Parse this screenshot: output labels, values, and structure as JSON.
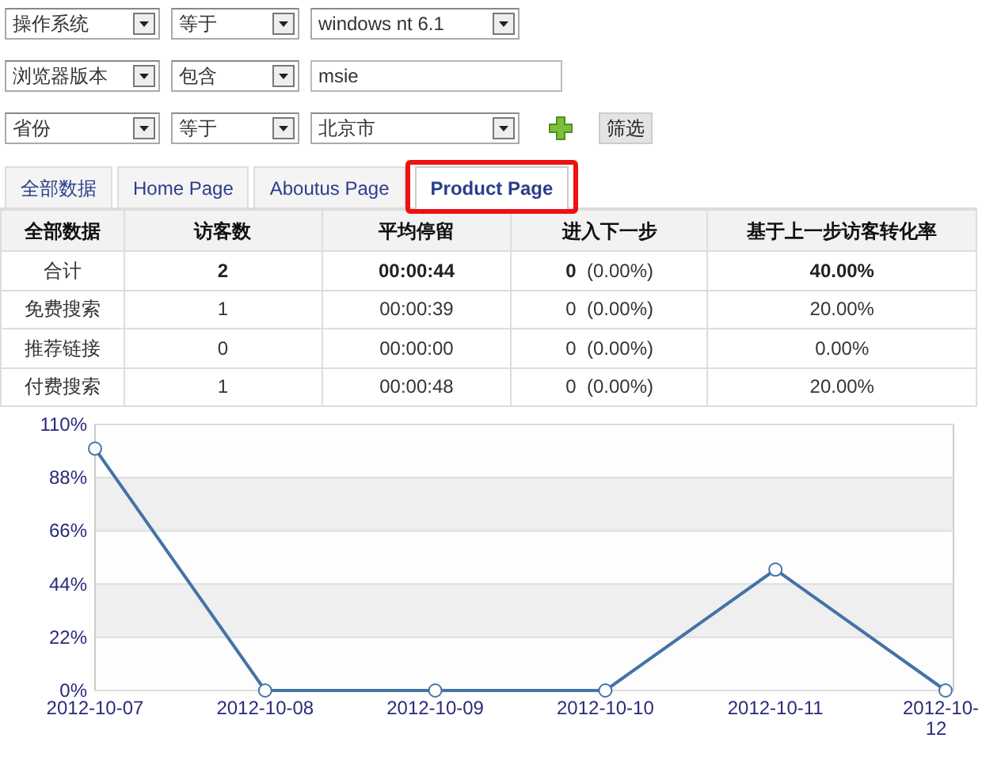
{
  "filters": [
    {
      "kind": "dropdown",
      "field": "操作系统",
      "operator": "等于",
      "value": "windows nt 6.1"
    },
    {
      "kind": "text",
      "field": "浏览器版本",
      "operator": "包含",
      "value": "msie"
    },
    {
      "kind": "dropdown",
      "field": "省份",
      "operator": "等于",
      "value": "北京市"
    }
  ],
  "filter_button": "筛选",
  "tabs": [
    {
      "label": "全部数据",
      "selected": false,
      "highlighted": false
    },
    {
      "label": "Home Page",
      "selected": false,
      "highlighted": false
    },
    {
      "label": "Aboutus Page",
      "selected": false,
      "highlighted": false
    },
    {
      "label": "Product Page",
      "selected": true,
      "highlighted": true
    }
  ],
  "table": {
    "columns": [
      "全部数据",
      "访客数",
      "平均停留",
      "进入下一步",
      "基于上一步访客转化率"
    ],
    "rows": [
      {
        "kind": "total",
        "label": "合计",
        "visitors": "2",
        "avg_stay": "00:00:44",
        "next_count": "0",
        "next_percent": "(0.00%)",
        "conversion": "40.00%"
      },
      {
        "kind": "detail",
        "label": "免费搜索",
        "visitors": "1",
        "avg_stay": "00:00:39",
        "next_count": "0",
        "next_percent": "(0.00%)",
        "conversion": "20.00%"
      },
      {
        "kind": "detail",
        "label": "推荐链接",
        "visitors": "0",
        "avg_stay": "00:00:00",
        "next_count": "0",
        "next_percent": "(0.00%)",
        "conversion": "0.00%"
      },
      {
        "kind": "detail",
        "label": "付费搜索",
        "visitors": "1",
        "avg_stay": "00:00:48",
        "next_count": "0",
        "next_percent": "(0.00%)",
        "conversion": "20.00%"
      }
    ]
  },
  "chart": {
    "chart_data": {
      "type": "line",
      "categories": [
        "2012-10-07",
        "2012-10-08",
        "2012-10-09",
        "2012-10-10",
        "2012-10-11",
        "2012-10-12"
      ],
      "series": [
        {
          "color": "#4572a7",
          "marker": "circle",
          "values": [
            100,
            0,
            0,
            0,
            50,
            0
          ]
        }
      ],
      "grid": true,
      "ylim": [
        0,
        110
      ],
      "yticks": [
        {
          "value": 0,
          "label": "0%"
        },
        {
          "value": 22,
          "label": "22%"
        },
        {
          "value": 44,
          "label": "44%"
        },
        {
          "value": 66,
          "label": "66%"
        },
        {
          "value": 88,
          "label": "88%"
        },
        {
          "value": 110,
          "label": "110%"
        }
      ]
    }
  }
}
